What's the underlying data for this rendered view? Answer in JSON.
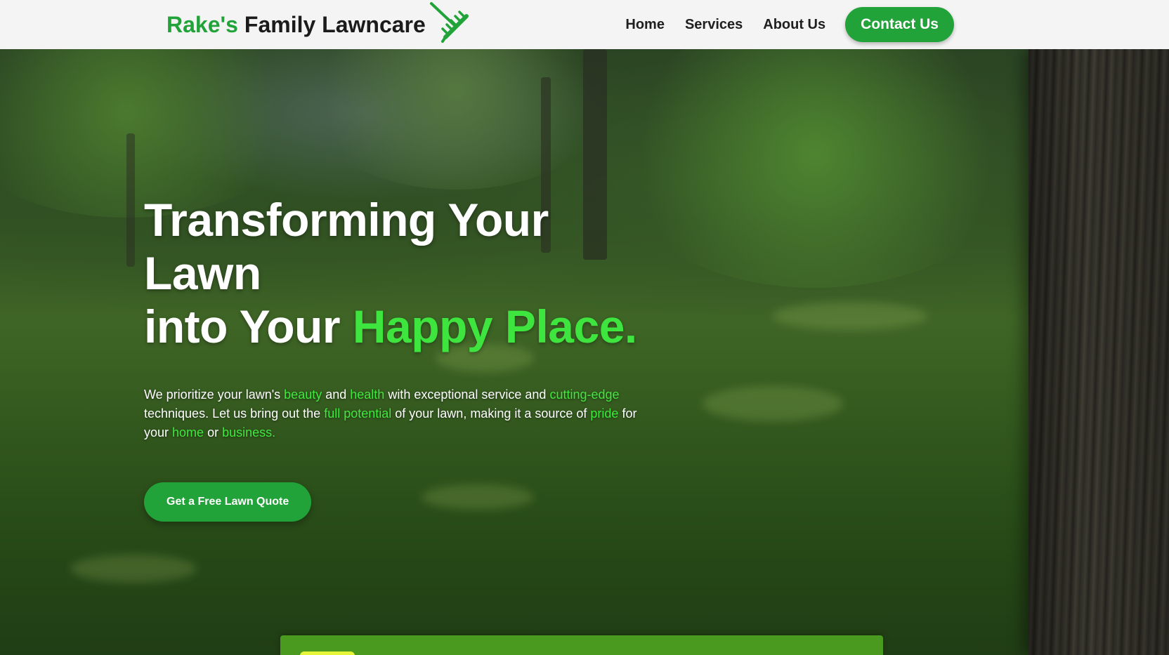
{
  "header": {
    "brand_accent": "Rake's",
    "brand_rest": "Family Lawncare",
    "logo_icon": "rake-icon",
    "nav": [
      {
        "label": "Home"
      },
      {
        "label": "Services"
      },
      {
        "label": "About Us"
      }
    ],
    "contact_label": "Contact Us"
  },
  "hero": {
    "headline_line1": "Transforming Your Lawn",
    "headline_line2_start": "into Your ",
    "headline_line2_accent": "Happy Place.",
    "sub": {
      "p1": "We prioritize your lawn's ",
      "h1": "beauty",
      "p2": " and ",
      "h2": "health",
      "p3": " with exceptional service and ",
      "h3": "cutting-edge",
      "p4": " techniques. Let us bring out the ",
      "h4": "full potential",
      "p5": " of your lawn, making it a source of ",
      "h5": "pride",
      "p6": " for your ",
      "h6": "home",
      "p7": " or ",
      "h7": "business."
    },
    "cta_label": "Get a Free Lawn Quote"
  },
  "colors": {
    "brand_green": "#22a33a",
    "highlight_green": "#3fe53f",
    "header_bg": "#f4f4f4"
  }
}
